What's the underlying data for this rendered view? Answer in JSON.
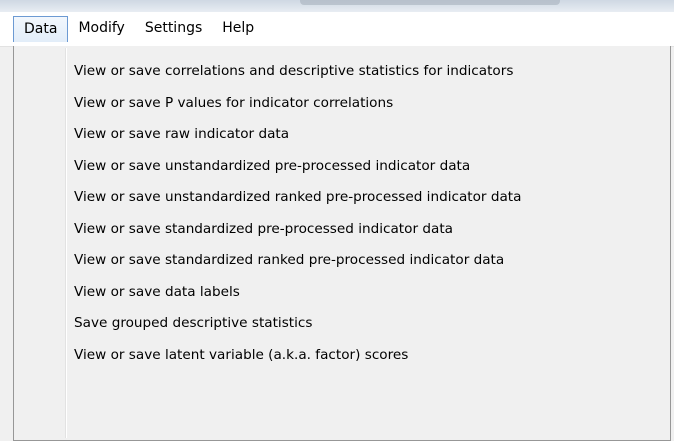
{
  "menubar": {
    "items": [
      {
        "label": "Data",
        "active": true
      },
      {
        "label": "Modify",
        "active": false
      },
      {
        "label": "Settings",
        "active": false
      },
      {
        "label": "Help",
        "active": false
      }
    ]
  },
  "data_menu": {
    "items": [
      {
        "label": "View or save correlations and descriptive statistics for indicators"
      },
      {
        "label": "View or save P values for indicator correlations"
      },
      {
        "label": "View or save raw indicator data"
      },
      {
        "label": "View or save unstandardized pre-processed indicator data"
      },
      {
        "label": "View or save unstandardized ranked pre-processed indicator data"
      },
      {
        "label": "View or save standardized pre-processed indicator data"
      },
      {
        "label": "View or save standardized ranked pre-processed indicator data"
      },
      {
        "label": "View or save data labels"
      },
      {
        "label": "Save grouped descriptive statistics"
      },
      {
        "label": "View or save latent variable (a.k.a. factor) scores"
      }
    ]
  }
}
